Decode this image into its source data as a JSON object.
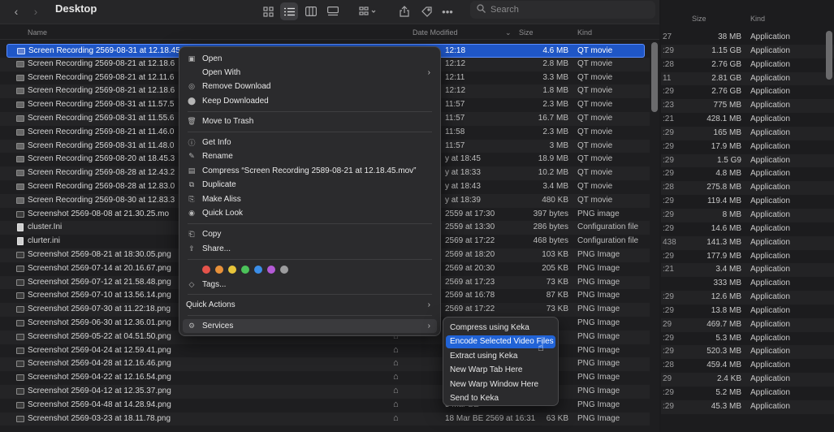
{
  "window": {
    "title": "Desktop",
    "search_placeholder": "Search"
  },
  "columns": {
    "name": "Name",
    "date_modified": "Date Modified",
    "size": "Size",
    "kind": "Kind"
  },
  "files": [
    {
      "name": "Screen Recording 2569-08-31 at 12.18.45",
      "date": "12:18",
      "size": "4.6 MB",
      "kind": "QT movie",
      "icon": "movie",
      "cloud": ""
    },
    {
      "name": "Screen Recording 2569-08-21 at 12.18.6",
      "date": "12:12",
      "size": "2.8 MB",
      "kind": "QT movie",
      "icon": "movie",
      "cloud": ""
    },
    {
      "name": "Screen Recording 2569-08-21 at 12.11.6",
      "date": "12:11",
      "size": "3.3 MB",
      "kind": "QT movie",
      "icon": "movie",
      "cloud": ""
    },
    {
      "name": "Screen Recording 2569-08-21 at 12.18.6",
      "date": "12:12",
      "size": "1.8 MB",
      "kind": "QT movie",
      "icon": "movie",
      "cloud": ""
    },
    {
      "name": "Screen Recording 2569-08-31 at 11.57.5",
      "date": "11:57",
      "size": "2.3 MB",
      "kind": "QT movie",
      "icon": "movie",
      "cloud": ""
    },
    {
      "name": "Screen Recording 2569-08-31 at 11.55.6",
      "date": "11:57",
      "size": "16.7 MB",
      "kind": "QT movie",
      "icon": "movie",
      "cloud": ""
    },
    {
      "name": "Screen Recording 2569-08-21 at 11.46.0",
      "date": "11:58",
      "size": "2.3 MB",
      "kind": "QT movie",
      "icon": "movie",
      "cloud": ""
    },
    {
      "name": "Screen Recording 2569-08-31 at 11.48.0",
      "date": "11:57",
      "size": "3 MB",
      "kind": "QT movie",
      "icon": "movie",
      "cloud": ""
    },
    {
      "name": "Screen Recording 2569-08-20 at 18.45.3",
      "date": "y at 18:45",
      "size": "18.9 MB",
      "kind": "QT movie",
      "icon": "movie",
      "cloud": ""
    },
    {
      "name": "Screen Recording 2569-08-28 at 12.43.2",
      "date": "y at 18:33",
      "size": "10.2 MB",
      "kind": "QT movie",
      "icon": "movie",
      "cloud": ""
    },
    {
      "name": "Screen Recording 2569-08-28 at 12.83.0",
      "date": "y at 18:43",
      "size": "3.4 MB",
      "kind": "QT movie",
      "icon": "movie",
      "cloud": ""
    },
    {
      "name": "Screen Recording 2569-08-30 at 12.83.3",
      "date": "y at 18:39",
      "size": "480 KB",
      "kind": "QT movie",
      "icon": "movie",
      "cloud": ""
    },
    {
      "name": "Screenshot 2569-08-08 at 21.30.25.mo",
      "date": "2559 at 17:30",
      "size": "397 bytes",
      "kind": "PNG image",
      "icon": "image",
      "cloud": ""
    },
    {
      "name": "cluster.Ini",
      "date": "2559 at 13:30",
      "size": "286 bytes",
      "kind": "Configuration file",
      "icon": "doc",
      "cloud": ""
    },
    {
      "name": "clurter.ini",
      "date": "2569 at 17:22",
      "size": "468 bytes",
      "kind": "Configuration file",
      "icon": "doc",
      "cloud": ""
    },
    {
      "name": "Screenshot 2569-08-21 at 18:30.05.png",
      "date": "2569 at 18:20",
      "size": "103 KB",
      "kind": "PNG Image",
      "icon": "image",
      "cloud": ""
    },
    {
      "name": "Screenshot 2569-07-14 at 20.16.67.png",
      "date": "2569 at 20:30",
      "size": "205 KB",
      "kind": "PNG Image",
      "icon": "image",
      "cloud": ""
    },
    {
      "name": "Screenshot 2569-07-12 at 21.58.48.png",
      "date": "2569 at 17:23",
      "size": "73 KB",
      "kind": "PNG Image",
      "icon": "image",
      "cloud": ""
    },
    {
      "name": "Screenshot 2569-07-10 at 13.56.14.png",
      "date": "2569 at 16:78",
      "size": "87 KB",
      "kind": "PNG Image",
      "icon": "image",
      "cloud": ""
    },
    {
      "name": "Screenshot 2569-07-30 at 11.22:18.png",
      "date": "2569 at 17:22",
      "size": "73 KB",
      "kind": "PNG Image",
      "icon": "image",
      "cloud": ""
    },
    {
      "name": "Screenshot 2569-06-30 at 12.36.01.png",
      "date": "",
      "size": "",
      "kind": "PNG Image",
      "icon": "image",
      "cloud": ""
    },
    {
      "name": "Screenshot 2569-05-22 at 04.51.50.png",
      "date": "",
      "size": "",
      "kind": "PNG Image",
      "icon": "image",
      "cloud": "⌂"
    },
    {
      "name": "Screenshot 2569-04-24 at 12.59.41.png",
      "date": "28 Apr",
      "size": "",
      "kind": "PNG Image",
      "icon": "image",
      "cloud": "⌂"
    },
    {
      "name": "Screenshot 2569-04-28 at 12.16.46.png",
      "date": "28 Apr",
      "size": "",
      "kind": "PNG Image",
      "icon": "image",
      "cloud": "⌂"
    },
    {
      "name": "Screenshot 2569-04-22 at 12.16.54.png",
      "date": "22 Apr",
      "size": "",
      "kind": "PNG Image",
      "icon": "image",
      "cloud": "⌂"
    },
    {
      "name": "Screenshot 2569-04-12 at 12.35.37.png",
      "date": "12 Apr",
      "size": "",
      "kind": "PNG Image",
      "icon": "image",
      "cloud": "⌂"
    },
    {
      "name": "Screenshot 2569-04-48 at 14.28.94.png",
      "date": "5 Mar BE",
      "size": "",
      "kind": "PNG Image",
      "icon": "image",
      "cloud": "⌂"
    },
    {
      "name": "Screenshot 2569-03-23 at 18.11.78.png",
      "date": "18 Mar BE 2569 at 16:31",
      "size": "63 KB",
      "kind": "PNG Image",
      "icon": "image",
      "cloud": "⌂"
    }
  ],
  "right_window": {
    "columns": {
      "size": "Size",
      "kind": "Kind"
    },
    "rows": [
      {
        "date": "27",
        "size": "38 MB",
        "kind": "Application"
      },
      {
        "date": ":29",
        "size": "1.15 GB",
        "kind": "Application"
      },
      {
        "date": ":28",
        "size": "2.76 GB",
        "kind": "Application"
      },
      {
        "date": "11",
        "size": "2.81 GB",
        "kind": "Application"
      },
      {
        "date": ":29",
        "size": "2.76 GB",
        "kind": "Application"
      },
      {
        "date": ":23",
        "size": "775 MB",
        "kind": "Application"
      },
      {
        "date": ":21",
        "size": "428.1 MB",
        "kind": "Application"
      },
      {
        "date": ":29",
        "size": "165 MB",
        "kind": "Application"
      },
      {
        "date": ":29",
        "size": "17.9 MB",
        "kind": "Application"
      },
      {
        "date": ":29",
        "size": "1.5 G9",
        "kind": "Application"
      },
      {
        "date": ":29",
        "size": "4.8 MB",
        "kind": "Application"
      },
      {
        "date": ":28",
        "size": "275.8 MB",
        "kind": "Application"
      },
      {
        "date": ":29",
        "size": "119.4 MB",
        "kind": "Application"
      },
      {
        "date": ":29",
        "size": "8 MB",
        "kind": "Application"
      },
      {
        "date": ":29",
        "size": "14.6 MB",
        "kind": "Application"
      },
      {
        "date": "438",
        "size": "141.3 MB",
        "kind": "Application"
      },
      {
        "date": ":29",
        "size": "177.9 MB",
        "kind": "Application"
      },
      {
        "date": ":21",
        "size": "3.4 MB",
        "kind": "Application"
      },
      {
        "date": "",
        "size": "333 MB",
        "kind": "Application"
      },
      {
        "date": ":29",
        "size": "12.6 MB",
        "kind": "Application"
      },
      {
        "date": ":29",
        "size": "13.8 MB",
        "kind": "Application"
      },
      {
        "date": "29",
        "size": "469.7 MB",
        "kind": "Application"
      },
      {
        "date": ":29",
        "size": "5.3 MB",
        "kind": "Application"
      },
      {
        "date": ":29",
        "size": "520.3 MB",
        "kind": "Application"
      },
      {
        "date": ":28",
        "size": "459.4 MB",
        "kind": "Application"
      },
      {
        "date": "29",
        "size": "2.4 KB",
        "kind": "Application"
      },
      {
        "date": ":29",
        "size": "5.2 MB",
        "kind": "Application"
      },
      {
        "date": ":29",
        "size": "45.3 MB",
        "kind": "Application"
      }
    ]
  },
  "context_menu": {
    "open": "Open",
    "open_with": "Open With",
    "remove_download": "Remove Download",
    "keep_downloaded": "Keep Downloaded",
    "move_to_trash": "Move to Trash",
    "get_info": "Get Info",
    "rename": "Rename",
    "compress": "Compress “Screen Recording 2589-08-21 at 12.18.45.mov”",
    "duplicate": "Duplicate",
    "make_alias": "Make Aliss",
    "quick_look": "Quick Look",
    "copy": "Copy",
    "share": "Share...",
    "tags": "Tags...",
    "quick_actions": "Quick Actions",
    "services": "Services",
    "tag_colors": [
      "#e5534b",
      "#e8913a",
      "#e8c53a",
      "#4cc35a",
      "#3b8ee8",
      "#b45ad6",
      "#9c9c9e"
    ]
  },
  "services_submenu": [
    {
      "label": "Compress using Keka",
      "highlighted": false
    },
    {
      "label": "Encode Selected Video Files",
      "highlighted": true
    },
    {
      "label": "Extract using Keka",
      "highlighted": false
    },
    {
      "label": "New Warp Tab Here",
      "highlighted": false
    },
    {
      "label": "New Warp Window Here",
      "highlighted": false
    },
    {
      "label": "Send to Keka",
      "highlighted": false
    }
  ]
}
